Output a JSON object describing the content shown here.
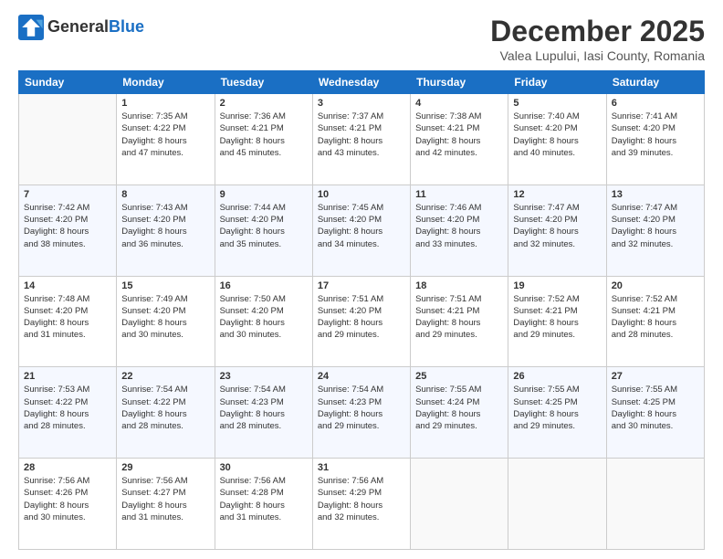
{
  "logo": {
    "line1": "General",
    "line2": "Blue"
  },
  "header": {
    "month": "December 2025",
    "location": "Valea Lupului, Iasi County, Romania"
  },
  "weekdays": [
    "Sunday",
    "Monday",
    "Tuesday",
    "Wednesday",
    "Thursday",
    "Friday",
    "Saturday"
  ],
  "weeks": [
    [
      {
        "day": "",
        "info": ""
      },
      {
        "day": "1",
        "info": "Sunrise: 7:35 AM\nSunset: 4:22 PM\nDaylight: 8 hours\nand 47 minutes."
      },
      {
        "day": "2",
        "info": "Sunrise: 7:36 AM\nSunset: 4:21 PM\nDaylight: 8 hours\nand 45 minutes."
      },
      {
        "day": "3",
        "info": "Sunrise: 7:37 AM\nSunset: 4:21 PM\nDaylight: 8 hours\nand 43 minutes."
      },
      {
        "day": "4",
        "info": "Sunrise: 7:38 AM\nSunset: 4:21 PM\nDaylight: 8 hours\nand 42 minutes."
      },
      {
        "day": "5",
        "info": "Sunrise: 7:40 AM\nSunset: 4:20 PM\nDaylight: 8 hours\nand 40 minutes."
      },
      {
        "day": "6",
        "info": "Sunrise: 7:41 AM\nSunset: 4:20 PM\nDaylight: 8 hours\nand 39 minutes."
      }
    ],
    [
      {
        "day": "7",
        "info": "Sunrise: 7:42 AM\nSunset: 4:20 PM\nDaylight: 8 hours\nand 38 minutes."
      },
      {
        "day": "8",
        "info": "Sunrise: 7:43 AM\nSunset: 4:20 PM\nDaylight: 8 hours\nand 36 minutes."
      },
      {
        "day": "9",
        "info": "Sunrise: 7:44 AM\nSunset: 4:20 PM\nDaylight: 8 hours\nand 35 minutes."
      },
      {
        "day": "10",
        "info": "Sunrise: 7:45 AM\nSunset: 4:20 PM\nDaylight: 8 hours\nand 34 minutes."
      },
      {
        "day": "11",
        "info": "Sunrise: 7:46 AM\nSunset: 4:20 PM\nDaylight: 8 hours\nand 33 minutes."
      },
      {
        "day": "12",
        "info": "Sunrise: 7:47 AM\nSunset: 4:20 PM\nDaylight: 8 hours\nand 32 minutes."
      },
      {
        "day": "13",
        "info": "Sunrise: 7:47 AM\nSunset: 4:20 PM\nDaylight: 8 hours\nand 32 minutes."
      }
    ],
    [
      {
        "day": "14",
        "info": "Sunrise: 7:48 AM\nSunset: 4:20 PM\nDaylight: 8 hours\nand 31 minutes."
      },
      {
        "day": "15",
        "info": "Sunrise: 7:49 AM\nSunset: 4:20 PM\nDaylight: 8 hours\nand 30 minutes."
      },
      {
        "day": "16",
        "info": "Sunrise: 7:50 AM\nSunset: 4:20 PM\nDaylight: 8 hours\nand 30 minutes."
      },
      {
        "day": "17",
        "info": "Sunrise: 7:51 AM\nSunset: 4:20 PM\nDaylight: 8 hours\nand 29 minutes."
      },
      {
        "day": "18",
        "info": "Sunrise: 7:51 AM\nSunset: 4:21 PM\nDaylight: 8 hours\nand 29 minutes."
      },
      {
        "day": "19",
        "info": "Sunrise: 7:52 AM\nSunset: 4:21 PM\nDaylight: 8 hours\nand 29 minutes."
      },
      {
        "day": "20",
        "info": "Sunrise: 7:52 AM\nSunset: 4:21 PM\nDaylight: 8 hours\nand 28 minutes."
      }
    ],
    [
      {
        "day": "21",
        "info": "Sunrise: 7:53 AM\nSunset: 4:22 PM\nDaylight: 8 hours\nand 28 minutes."
      },
      {
        "day": "22",
        "info": "Sunrise: 7:54 AM\nSunset: 4:22 PM\nDaylight: 8 hours\nand 28 minutes."
      },
      {
        "day": "23",
        "info": "Sunrise: 7:54 AM\nSunset: 4:23 PM\nDaylight: 8 hours\nand 28 minutes."
      },
      {
        "day": "24",
        "info": "Sunrise: 7:54 AM\nSunset: 4:23 PM\nDaylight: 8 hours\nand 29 minutes."
      },
      {
        "day": "25",
        "info": "Sunrise: 7:55 AM\nSunset: 4:24 PM\nDaylight: 8 hours\nand 29 minutes."
      },
      {
        "day": "26",
        "info": "Sunrise: 7:55 AM\nSunset: 4:25 PM\nDaylight: 8 hours\nand 29 minutes."
      },
      {
        "day": "27",
        "info": "Sunrise: 7:55 AM\nSunset: 4:25 PM\nDaylight: 8 hours\nand 30 minutes."
      }
    ],
    [
      {
        "day": "28",
        "info": "Sunrise: 7:56 AM\nSunset: 4:26 PM\nDaylight: 8 hours\nand 30 minutes."
      },
      {
        "day": "29",
        "info": "Sunrise: 7:56 AM\nSunset: 4:27 PM\nDaylight: 8 hours\nand 31 minutes."
      },
      {
        "day": "30",
        "info": "Sunrise: 7:56 AM\nSunset: 4:28 PM\nDaylight: 8 hours\nand 31 minutes."
      },
      {
        "day": "31",
        "info": "Sunrise: 7:56 AM\nSunset: 4:29 PM\nDaylight: 8 hours\nand 32 minutes."
      },
      {
        "day": "",
        "info": ""
      },
      {
        "day": "",
        "info": ""
      },
      {
        "day": "",
        "info": ""
      }
    ]
  ]
}
